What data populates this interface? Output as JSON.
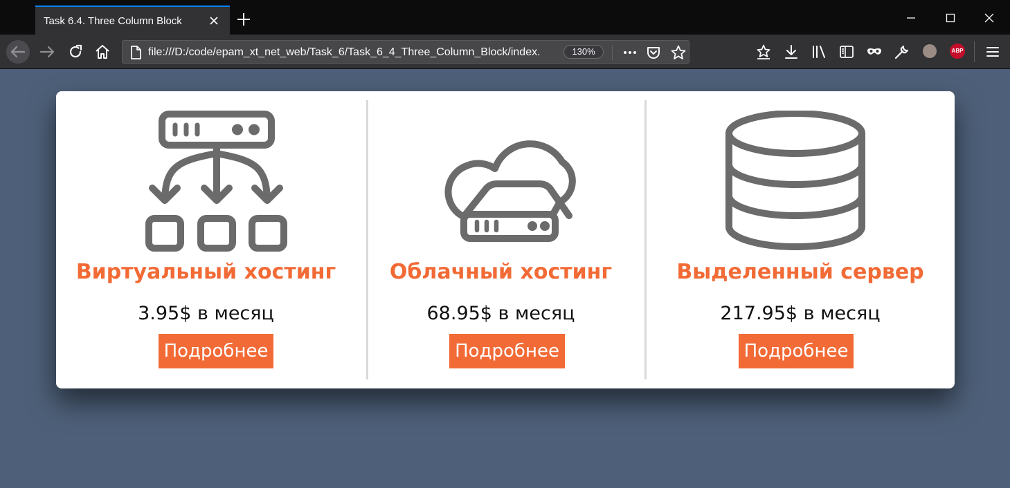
{
  "browser": {
    "tab_title": "Task 6.4. Three Column Block",
    "url": "file:///D:/code/epam_xt_net_web/Task_6/Task_6_4_Three_Column_Block/index.",
    "zoom": "130%",
    "extension_badge": "ABP",
    "icons": [
      "back-icon",
      "forward-icon",
      "reload-icon",
      "home-icon",
      "page-icon",
      "more-icon",
      "pocket-icon",
      "bookmark-star-icon",
      "feed-icon",
      "download-icon",
      "library-icon",
      "sidebar-icon",
      "mask-icon",
      "wrench-icon",
      "avatar",
      "menu-icon"
    ]
  },
  "columns": [
    {
      "icon": "server-network-icon",
      "title": "Виртуальный хостинг",
      "price": "3.95$ в месяц",
      "button": "Подробнее"
    },
    {
      "icon": "cloud-server-icon",
      "title": "Облачный хостинг",
      "price": "68.95$ в месяц",
      "button": "Подробнее"
    },
    {
      "icon": "database-icon",
      "title": "Выделенный сервер",
      "price": "217.95$ в месяц",
      "button": "Подробнее"
    }
  ],
  "colors": {
    "accent": "#f26a35",
    "page_background": "#4e6079",
    "icon_gray": "#6b6b6b"
  }
}
